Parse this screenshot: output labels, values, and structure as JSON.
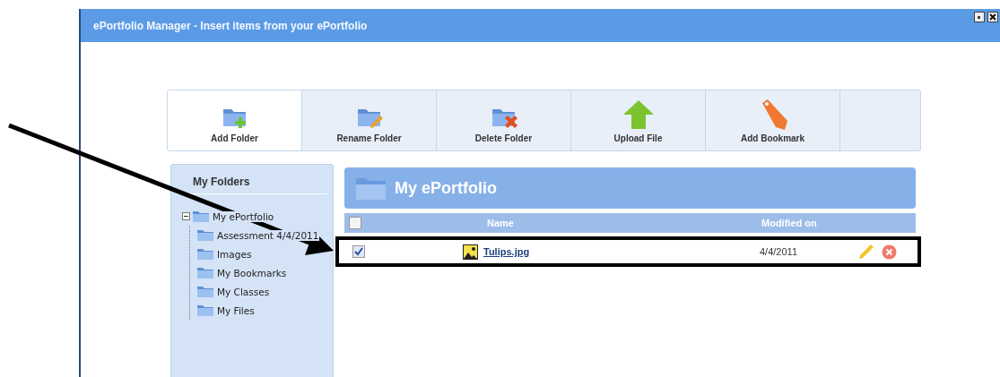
{
  "window": {
    "title": "ePortfolio Manager - Insert items from your ePortfolio"
  },
  "toolbar": [
    {
      "label": "Add Folder",
      "kind": "add",
      "selected": true
    },
    {
      "label": "Rename Folder",
      "kind": "rename",
      "selected": false
    },
    {
      "label": "Delete Folder",
      "kind": "delete",
      "selected": false
    },
    {
      "label": "Upload File",
      "kind": "upload",
      "selected": false
    },
    {
      "label": "Add Bookmark",
      "kind": "bookmark",
      "selected": false
    }
  ],
  "sidebar": {
    "title": "My Folders",
    "tree": [
      {
        "label": "My ePortfolio",
        "expanded": true,
        "children": [
          {
            "label": "Assessment 4/4/2011"
          },
          {
            "label": "Images"
          },
          {
            "label": "My Bookmarks"
          },
          {
            "label": "My Classes"
          },
          {
            "label": "My Files"
          }
        ]
      }
    ]
  },
  "main": {
    "title": "My ePortfolio",
    "header_checked": false,
    "columns": [
      "Name",
      "Modified on"
    ],
    "rows": [
      {
        "checked": true,
        "name": "Tulips.jpg",
        "modified": "4/4/2011",
        "highlighted": true
      }
    ]
  }
}
